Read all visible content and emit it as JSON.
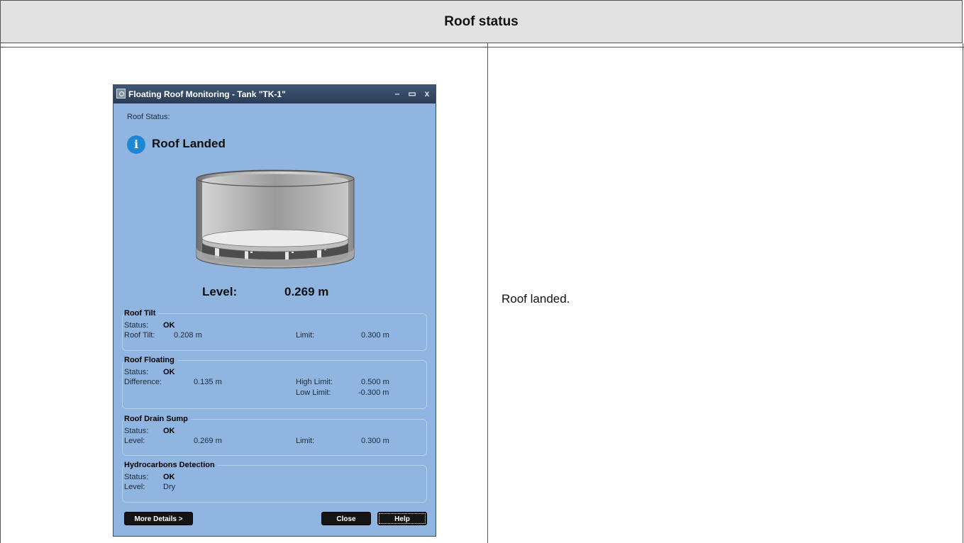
{
  "header": {
    "title": "Roof status"
  },
  "description": "Roof landed.",
  "window": {
    "title": "Floating Roof Monitoring - Tank \"TK-1\"",
    "minimize_glyph": "–",
    "maximize_glyph": "▭",
    "close_glyph": "x",
    "roof_status_label": "Roof Status:",
    "roof_status_value": "Roof Landed",
    "info_glyph": "i",
    "level_label": "Level:",
    "level_value": "0.269  m",
    "groups": {
      "tilt": {
        "title": "Roof Tilt",
        "status_label": "Status:",
        "status_value": "OK",
        "row_label": "Roof Tilt:",
        "row_value": "0.208 m",
        "limit_label": "Limit:",
        "limit_value": "0.300 m"
      },
      "floating": {
        "title": "Roof Floating",
        "status_label": "Status:",
        "status_value": "OK",
        "row_label": "Difference:",
        "row_value": "0.135 m",
        "high_label": "High Limit:",
        "high_value": "0.500 m",
        "low_label": "Low Limit:",
        "low_value": "-0.300 m"
      },
      "drain": {
        "title": "Roof Drain Sump",
        "status_label": "Status:",
        "status_value": "OK",
        "row_label": "Level:",
        "row_value": "0.269 m",
        "limit_label": "Limit:",
        "limit_value": "0.300 m"
      },
      "hydro": {
        "title": "Hydrocarbons Detection",
        "status_label": "Status:",
        "status_value": "OK",
        "row_label": "Level:",
        "row_value": "Dry"
      }
    },
    "buttons": {
      "more": "More Details >",
      "close": "Close",
      "help": "Help"
    }
  },
  "colors": {
    "window_bg": "#8fb5e0",
    "titlebar": "#2b3d55",
    "info": "#1f86d4"
  }
}
